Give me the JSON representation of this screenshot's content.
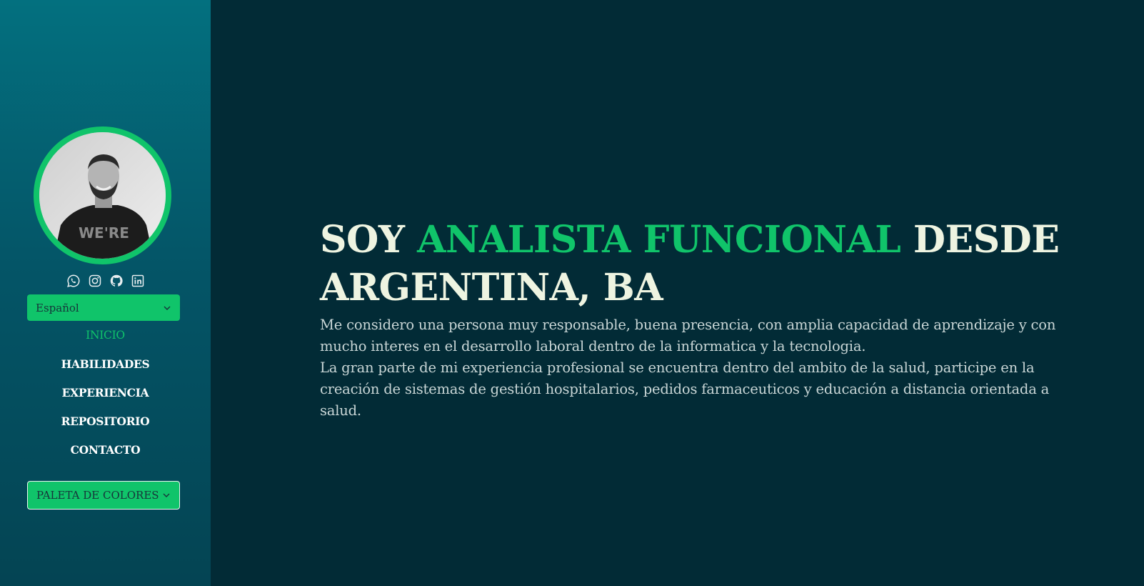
{
  "sidebar": {
    "language_select": {
      "value": "Español"
    },
    "socials": [
      {
        "icon": "whatsapp-icon"
      },
      {
        "icon": "instagram-icon"
      },
      {
        "icon": "github-icon"
      },
      {
        "icon": "linkedin-icon"
      }
    ],
    "nav": [
      {
        "label": "INICIO",
        "active": true
      },
      {
        "label": "HABILIDADES",
        "active": false
      },
      {
        "label": "EXPERIENCIA",
        "active": false
      },
      {
        "label": "REPOSITORIO",
        "active": false
      },
      {
        "label": "CONTACTO",
        "active": false
      }
    ],
    "palette_button": {
      "label": "PALETA DE COLORES"
    }
  },
  "hero": {
    "title_prefix": "SOY ",
    "title_accent": "ANALISTA FUNCIONAL",
    "title_suffix": " DESDE ARGENTINA, BA",
    "bio_line_1": "Me considero una persona muy responsable, buena presencia, con amplia capacidad de aprendizaje y con mucho interes en el desarrollo laboral dentro de la informatica y la tecnologia.",
    "bio_line_2": "La gran parte de mi experiencia profesional se encuentra dentro del ambito de la salud, participe en la creación de sistemas de gestión hospitalarios, pedidos farmaceuticos y educación a distancia orientada a salud."
  },
  "colors": {
    "accent": "#10c46a",
    "main_background": "#022b36",
    "sidebar_top": "#03707f",
    "heading_text": "#eef4e1"
  }
}
